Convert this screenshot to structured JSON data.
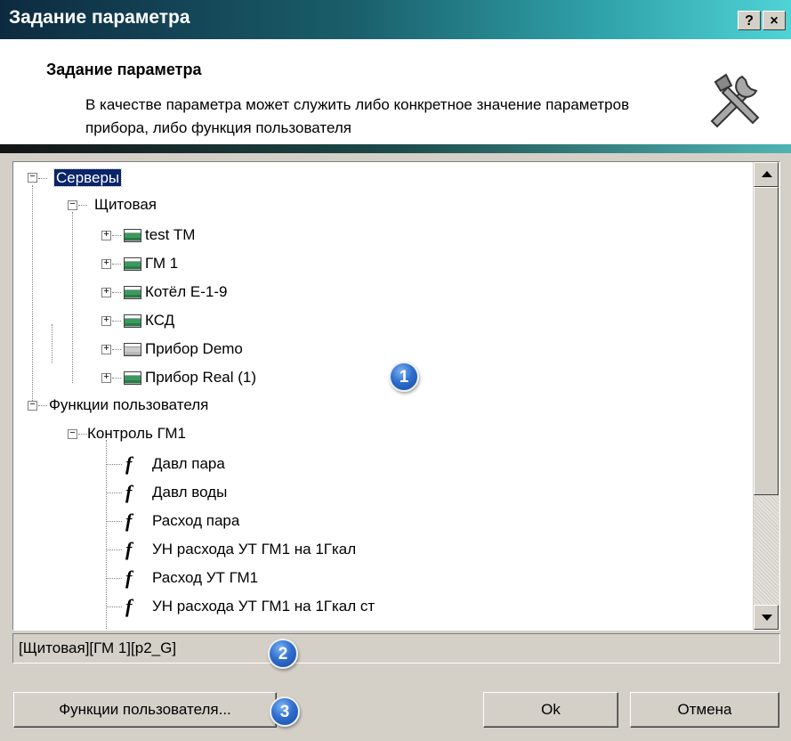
{
  "window": {
    "title": "Задание параметра",
    "help_label": "?",
    "close_label": "×"
  },
  "header": {
    "title": "Задание параметра",
    "description": "В качестве параметра может служить либо конкретное значение параметров прибора, либо  функция пользователя",
    "icon": "tools-icon"
  },
  "tree": {
    "servers": "Серверы",
    "group": "Щитовая",
    "devices": [
      "test TM",
      "ГМ 1",
      "Котёл Е-1-9",
      "КСД",
      "Прибор Demo",
      "Прибор Real (1)"
    ],
    "functions_root": "Функции пользователя",
    "function_group": "Контроль ГМ1",
    "functions": [
      "Давл пара",
      "Давл воды",
      "Расход пара",
      "УН расхода УТ ГМ1 на 1Гкал",
      "Расход УТ ГМ1",
      "УН расхода УТ ГМ1 на 1Гкал ст"
    ],
    "expand_plus": "+",
    "expand_minus": "−",
    "function_glyph": "f"
  },
  "status": {
    "path": "[Щитовая][ГМ 1][p2_G]"
  },
  "buttons": {
    "functions": "Функции пользователя...",
    "ok": "Ok",
    "cancel": "Отмена"
  },
  "callouts": [
    "1",
    "2",
    "3"
  ],
  "colors": {
    "selection": "#0a246a",
    "callout": "#2f6fd0"
  }
}
